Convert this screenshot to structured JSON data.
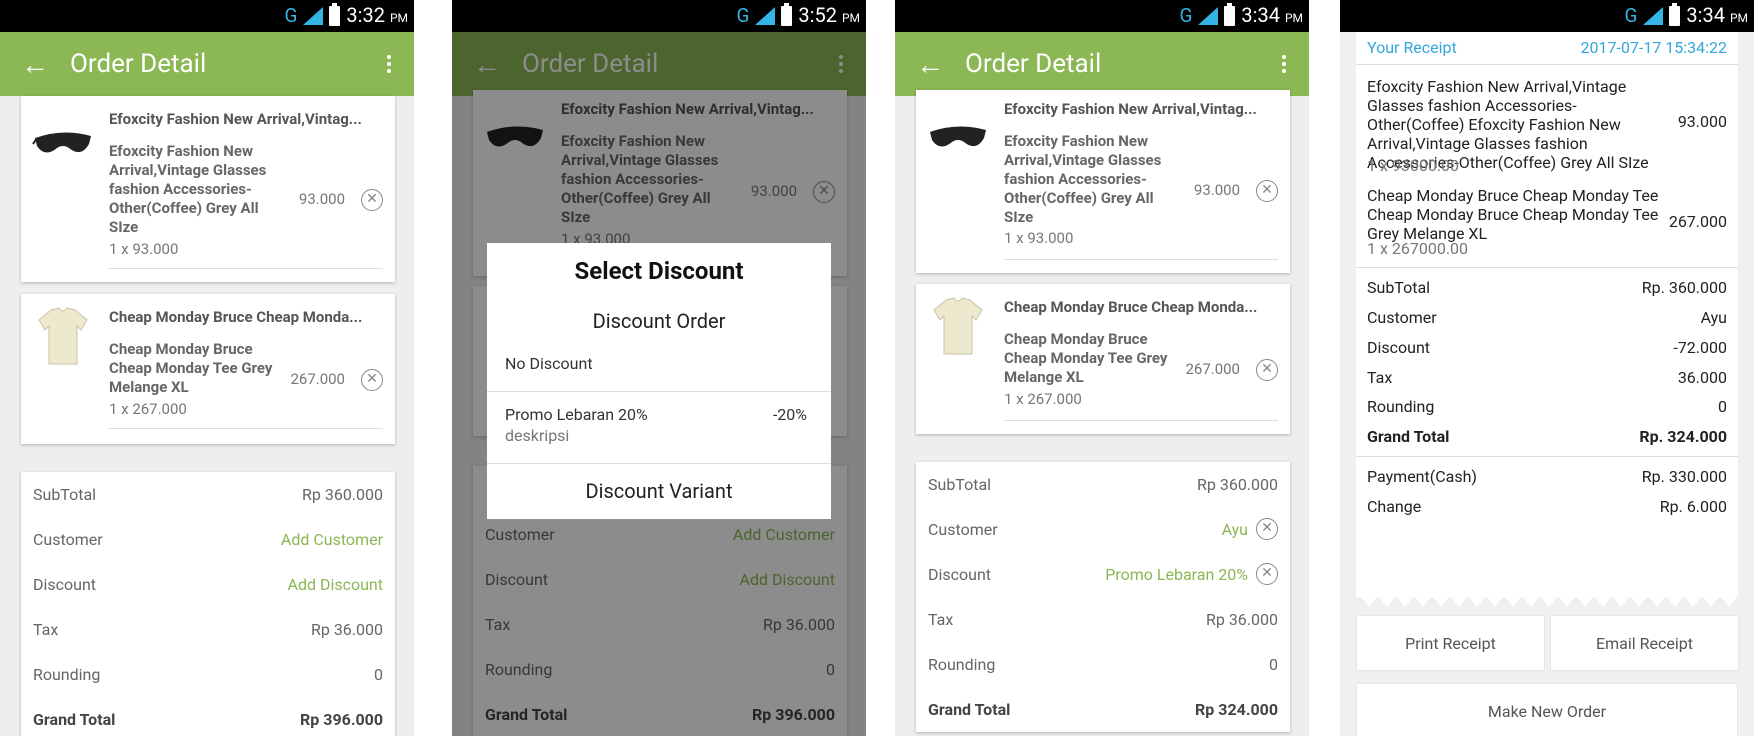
{
  "status_bar": [
    {
      "network": "G",
      "time": "3:32",
      "ampm": "PM"
    },
    {
      "network": "G",
      "time": "3:52",
      "ampm": "PM"
    },
    {
      "network": "G",
      "time": "3:34",
      "ampm": "PM"
    },
    {
      "network": "G",
      "time": "3:34",
      "ampm": "PM"
    }
  ],
  "screen1": {
    "title": "Order Detail",
    "items": [
      {
        "title": "Efoxcity Fashion New Arrival,Vintag...",
        "name": "Efoxcity Fashion New Arrival,Vintage Glasses fashion Accessories-Other(Coffee) Grey All SIze",
        "qty": "1 x 93.000",
        "price": "93.000"
      },
      {
        "title": "Cheap Monday Bruce Cheap Monda...",
        "name": "Cheap Monday Bruce Cheap Monday Tee Grey Melange XL",
        "qty": "1 x 267.000",
        "price": "267.000"
      }
    ],
    "summary": {
      "subtotal_label": "SubTotal",
      "subtotal": "Rp 360.000",
      "customer_label": "Customer",
      "customer": "Add Customer",
      "discount_label": "Discount",
      "discount": "Add Discount",
      "tax_label": "Tax",
      "tax": "Rp 36.000",
      "rounding_label": "Rounding",
      "rounding": "0",
      "grand_total_label": "Grand Total",
      "grand_total": "Rp 396.000"
    }
  },
  "screen2": {
    "title": "Order Detail",
    "items": [
      {
        "title": "Efoxcity Fashion New Arrival,Vintag...",
        "name": "Efoxcity Fashion New Arrival,Vintage Glasses fashion Accessories-Other(Coffee) Grey All SIze",
        "qty": "1 x 93.000",
        "price": "93.000"
      }
    ],
    "summary": {
      "customer_label": "Customer",
      "customer": "Add Customer",
      "discount_label": "Discount",
      "discount": "Add Discount",
      "tax_label": "Tax",
      "tax": "Rp 36.000",
      "rounding_label": "Rounding",
      "rounding": "0",
      "grand_total_label": "Grand Total",
      "grand_total": "Rp 396.000"
    },
    "dialog": {
      "title": "Select Discount",
      "section_order": "Discount Order",
      "no_discount": "No Discount",
      "promo_name": "Promo Lebaran 20%",
      "promo_value": "-20%",
      "promo_desc": "deskripsi",
      "section_variant": "Discount Variant"
    }
  },
  "screen3": {
    "title": "Order Detail",
    "items": [
      {
        "title": "Efoxcity Fashion New Arrival,Vintag...",
        "name": "Efoxcity Fashion New Arrival,Vintage Glasses fashion Accessories-Other(Coffee) Grey All SIze",
        "qty": "1 x 93.000",
        "price": "93.000"
      },
      {
        "title": "Cheap Monday Bruce Cheap Monda...",
        "name": "Cheap Monday Bruce Cheap Monday Tee Grey Melange XL",
        "qty": "1 x 267.000",
        "price": "267.000"
      }
    ],
    "summary": {
      "subtotal_label": "SubTotal",
      "subtotal": "Rp 360.000",
      "customer_label": "Customer",
      "customer": "Ayu",
      "discount_label": "Discount",
      "discount": "Promo Lebaran 20%",
      "tax_label": "Tax",
      "tax": "Rp 36.000",
      "rounding_label": "Rounding",
      "rounding": "0",
      "grand_total_label": "Grand Total",
      "grand_total": "Rp 324.000"
    }
  },
  "screen4": {
    "receipt_title": "Your Receipt",
    "datetime": "2017-07-17 15:34:22",
    "items": [
      {
        "name": "Efoxcity Fashion New Arrival,Vintage Glasses fashion Accessories-Other(Coffee) Efoxcity Fashion New Arrival,Vintage Glasses fashion Accessories-Other(Coffee) Grey All SIze",
        "qty": "1 x 93000.00",
        "price": "93.000"
      },
      {
        "name": "Cheap Monday Bruce Cheap Monday Tee Cheap Monday Bruce Cheap Monday Tee Grey Melange XL",
        "qty": "1 x 267000.00",
        "price": "267.000"
      }
    ],
    "summary": {
      "subtotal_label": "SubTotal",
      "subtotal": "Rp. 360.000",
      "customer_label": "Customer",
      "customer": "Ayu",
      "discount_label": "Discount",
      "discount": "-72.000",
      "tax_label": "Tax",
      "tax": "36.000",
      "rounding_label": "Rounding",
      "rounding": "0",
      "grand_total_label": "Grand Total",
      "grand_total": "Rp. 324.000",
      "payment_label": "Payment(Cash)",
      "payment": "Rp. 330.000",
      "change_label": "Change",
      "change": "Rp. 6.000"
    },
    "buttons": {
      "print": "Print Receipt",
      "email": "Email Receipt",
      "new_order": "Make New Order"
    }
  },
  "colors": {
    "appbar": "#8bb754",
    "accent_link": "#8bb754",
    "receipt_header": "#33a7dc"
  },
  "icons": [
    "back-arrow-icon",
    "overflow-menu-icon",
    "remove-circle-icon",
    "sunglasses-image",
    "tshirt-image",
    "signal-icon",
    "battery-icon"
  ]
}
